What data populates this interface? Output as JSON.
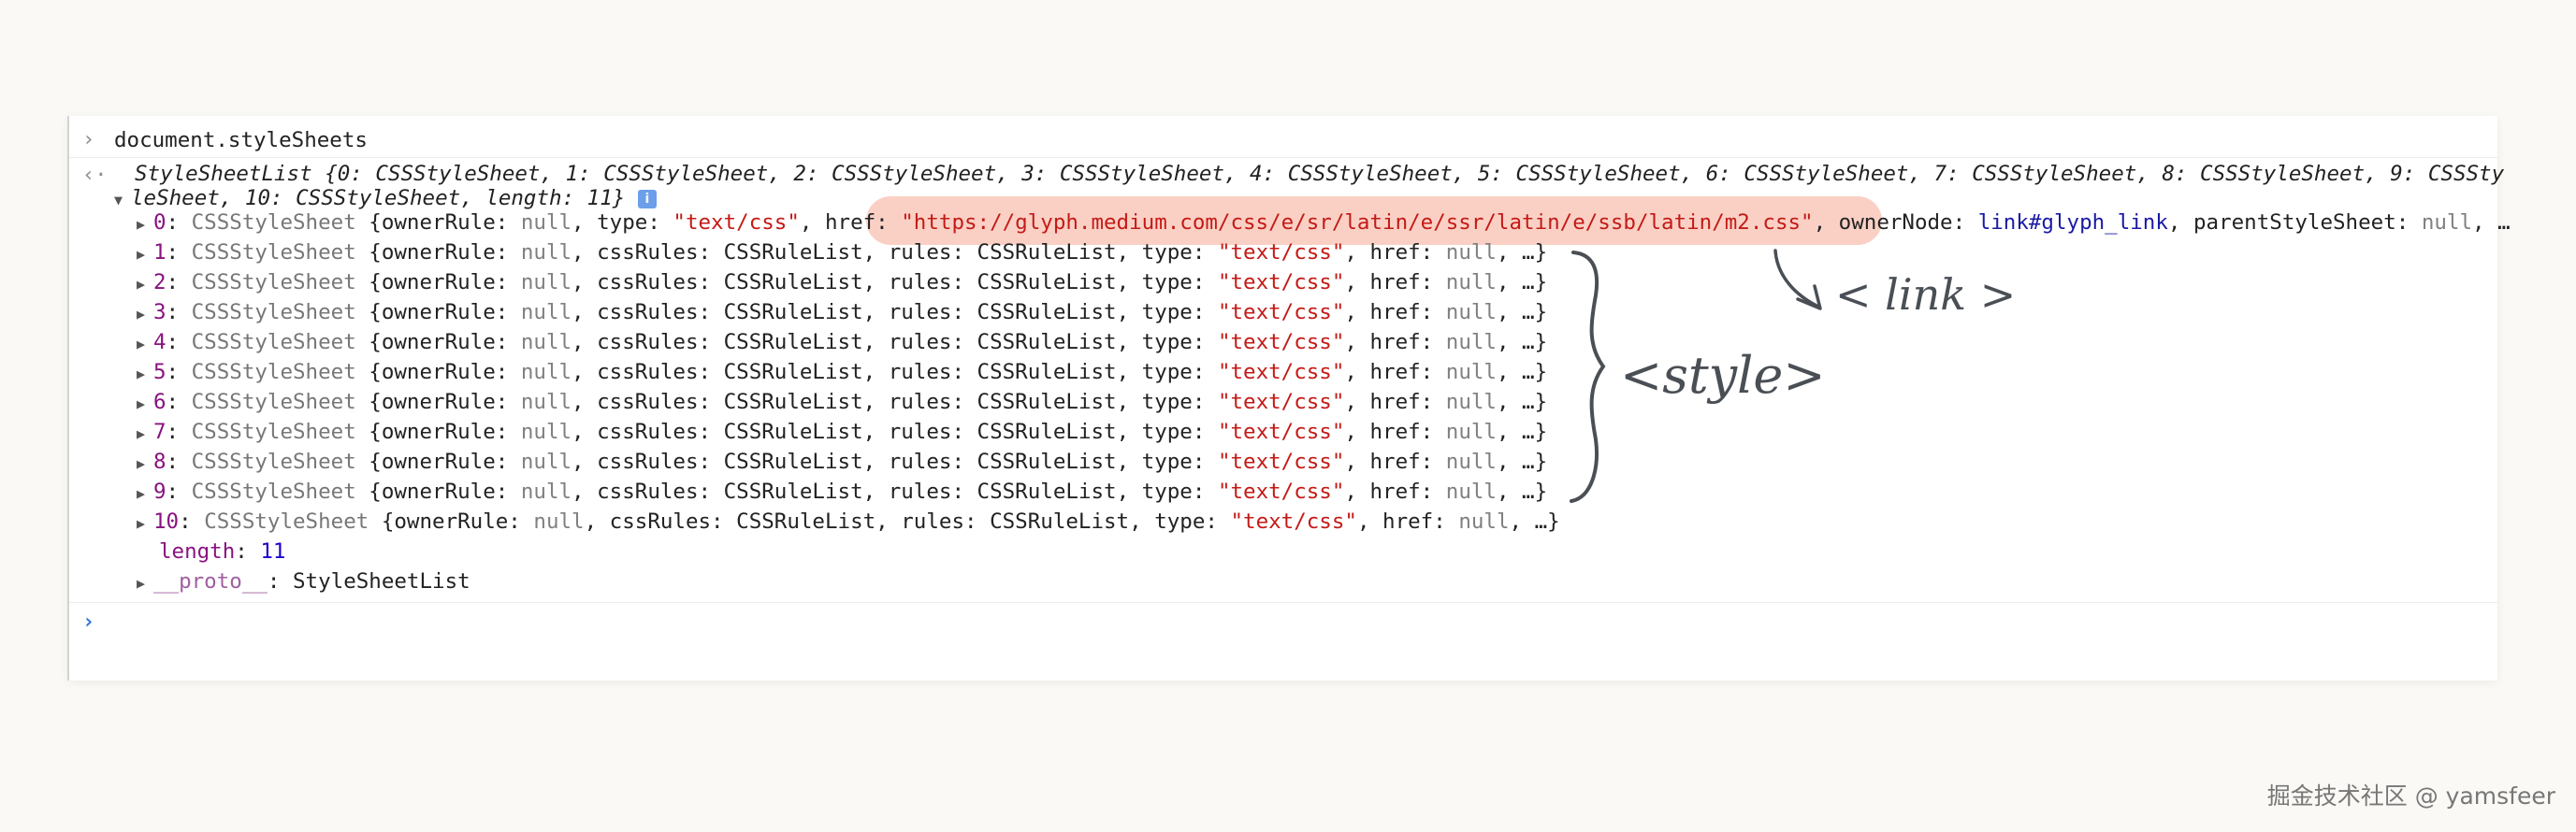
{
  "console": {
    "command": "document.styleSheets",
    "result_head": "StyleSheetList {0: CSSStyleSheet, 1: CSSStyleSheet, 2: CSSStyleSheet, 3: CSSStyleSheet, 4: CSSStyleSheet, 5: CSSStyleSheet, 6: CSSStyleSheet, 7: CSSStyleSheet, 8: CSSStyleSheet, 9: CSSSty",
    "result_wrap": "leSheet, 10: CSSStyleSheet, length: 11}",
    "info_badge": "i",
    "entry0": {
      "index": "0",
      "type_name": "CSSStyleSheet",
      "open": "{ownerRule: ",
      "null1": "null",
      "type_key": ", type: ",
      "type_val": "\"text/css\"",
      "href_key": ", href: ",
      "href_val": "\"https://glyph.medium.com/css/e/sr/latin/e/ssr/latin/e/ssb/latin/m2.css\"",
      "owner_key": ", ownerNode: ",
      "owner_val": "link#glyph_link",
      "parent_key": ", parentStyleSheet: ",
      "null2": "null",
      "tail": ", …"
    },
    "entries": [
      {
        "index": "1"
      },
      {
        "index": "2"
      },
      {
        "index": "3"
      },
      {
        "index": "4"
      },
      {
        "index": "5"
      },
      {
        "index": "6"
      },
      {
        "index": "7"
      },
      {
        "index": "8"
      },
      {
        "index": "9"
      },
      {
        "index": "10"
      }
    ],
    "entry_text": {
      "type_name": "CSSStyleSheet",
      "p1": " {ownerRule: ",
      "null": "null",
      "p2": ", cssRules: ",
      "rulelist": "CSSRuleList",
      "p3": ", rules: ",
      "p4": ", type: ",
      "type_val": "\"text/css\"",
      "p5": ", href: ",
      "p6": ", …}"
    },
    "length_key": "length",
    "length_val": "11",
    "proto_key": "__proto__",
    "proto_val": "StyleSheetList",
    "prompt_symbol": "›",
    "output_symbol": "‹·"
  },
  "annotations": {
    "link": "< link >",
    "style": "<style>"
  },
  "watermark": "掘金技术社区 @ yamsfeer",
  "colors": {
    "highlight": "#f6aa96",
    "string": "#c41a16",
    "key": "#881280",
    "prompt": "#2b6fdb"
  }
}
